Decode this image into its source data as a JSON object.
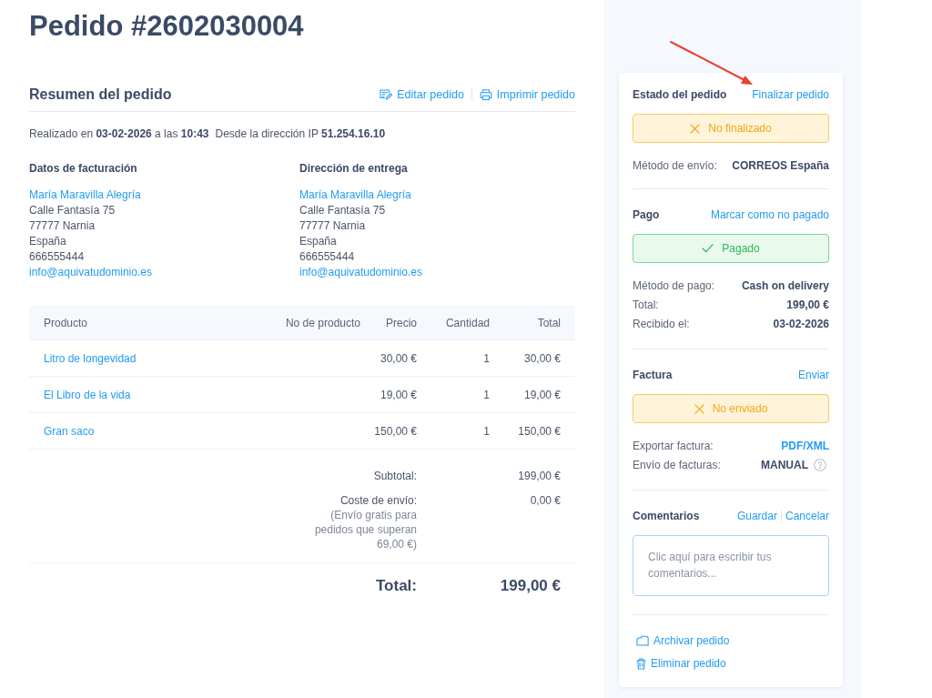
{
  "title": "Pedido #2602030004",
  "summary": {
    "heading": "Resumen del pedido",
    "actions": [
      {
        "label": "Editar pedido",
        "kind": "edit"
      },
      {
        "label": "Imprimir pedido",
        "kind": "print"
      }
    ],
    "placed": "Realizado en **03-02-2026** a las **10:43**",
    "ip": "Desde la dirección IP **51.254.16.10**"
  },
  "addresses": [
    {
      "heading": "Datos de facturación",
      "name": "María Maravilla Alegría",
      "lines": [
        "Calle Fantasía 75",
        "77777 Narnia",
        "España",
        "666555444"
      ],
      "email": "info@aquivatudominio.es"
    },
    {
      "heading": "Dirección de entrega",
      "name": "María Maravilla Alegría",
      "lines": [
        "Calle Fantasía 75",
        "77777 Narnia",
        "España",
        "666555444"
      ],
      "email": "info@aquivatudominio.es"
    }
  ],
  "table": {
    "columns": [
      "Producto",
      "No de producto",
      "Precio",
      "Cantidad",
      "Total"
    ],
    "rows": [
      {
        "product": "Litro de longevidad",
        "price": "30,00 €",
        "quantity": "1",
        "total": "30,00 €"
      },
      {
        "product": "El Libro de la vida",
        "price": "19,00 €",
        "quantity": "1",
        "total": "19,00 €"
      },
      {
        "product": "Gran saco",
        "price": "150,00 €",
        "quantity": "1",
        "total": "150,00 €"
      }
    ]
  },
  "totals": {
    "subtotal_label": "Subtotal:",
    "subtotal": "199,00 €",
    "shipping_label": "Coste de envío:",
    "shipping_note": "(Envío gratis para pedidos que superan 69,00 €)",
    "shipping": "0,00 €",
    "total_label": "Total:",
    "total": "199,00 €"
  },
  "panel": {
    "sections": [
      {
        "title": "Estado del pedido",
        "actions": [
          "Finalizar pedido"
        ],
        "status": {
          "label": "No finalizado",
          "kind": "warning"
        },
        "details": [
          {
            "label": "Método de envío:",
            "value": "CORREOS España",
            "kind": "text"
          }
        ]
      },
      {
        "title": "Pago",
        "actions": [
          "Marcar como no pagado"
        ],
        "status": {
          "label": "Pagado",
          "kind": "success"
        },
        "details": [
          {
            "label": "Método de pago:",
            "value": "Cash on delivery",
            "kind": "text"
          },
          {
            "label": "Total:",
            "value": "199,00 €",
            "kind": "text"
          },
          {
            "label": "Recibido el:",
            "value": "03-02-2026",
            "kind": "text"
          }
        ]
      },
      {
        "title": "Factura",
        "actions": [
          "Enviar"
        ],
        "status": {
          "label": "No enviado",
          "kind": "warning"
        },
        "details": [
          {
            "label": "Exportar factura:",
            "value": "PDF/XML",
            "kind": "link"
          },
          {
            "label": "Envío de facturas:",
            "value": "MANUAL",
            "kind": "help"
          }
        ]
      },
      {
        "title": "Comentarios",
        "actions": [
          "Guardar",
          "Cancelar"
        ],
        "comment": {
          "placeholder": "Clic aquí para escribir tus comentarios..."
        }
      }
    ],
    "actions": [
      {
        "label": "Archivar pedido",
        "kind": "archive"
      },
      {
        "label": "Eliminar pedido",
        "kind": "delete"
      }
    ]
  }
}
